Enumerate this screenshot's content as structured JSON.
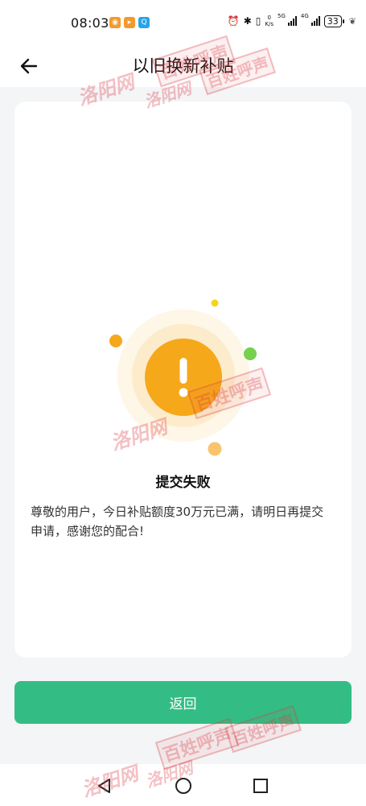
{
  "status_bar": {
    "time": "08:03",
    "speed_value": "0",
    "speed_unit": "K/s",
    "net_5g": "5G",
    "net_4g": "4G",
    "battery": "33",
    "app_icons": [
      {
        "name": "weibo-app-icon",
        "color": "#f39a2d",
        "glyph": "◉"
      },
      {
        "name": "video-app-icon",
        "color": "#f39a2d",
        "glyph": "▸"
      },
      {
        "name": "search-app-icon",
        "color": "#2aa3e8",
        "glyph": "Q"
      }
    ]
  },
  "header": {
    "title": "以旧换新补贴"
  },
  "result": {
    "title": "提交失败",
    "message": "尊敬的用户，今日补贴额度30万元已满，请明日再提交申请，感谢您的配合!"
  },
  "actions": {
    "return_label": "返回"
  },
  "watermark": {
    "text_a": "洛阳网",
    "text_b": "百姓呼声"
  },
  "colors": {
    "accent": "#33bd84",
    "warning": "#f6a81b",
    "background": "#f3f5f6"
  }
}
